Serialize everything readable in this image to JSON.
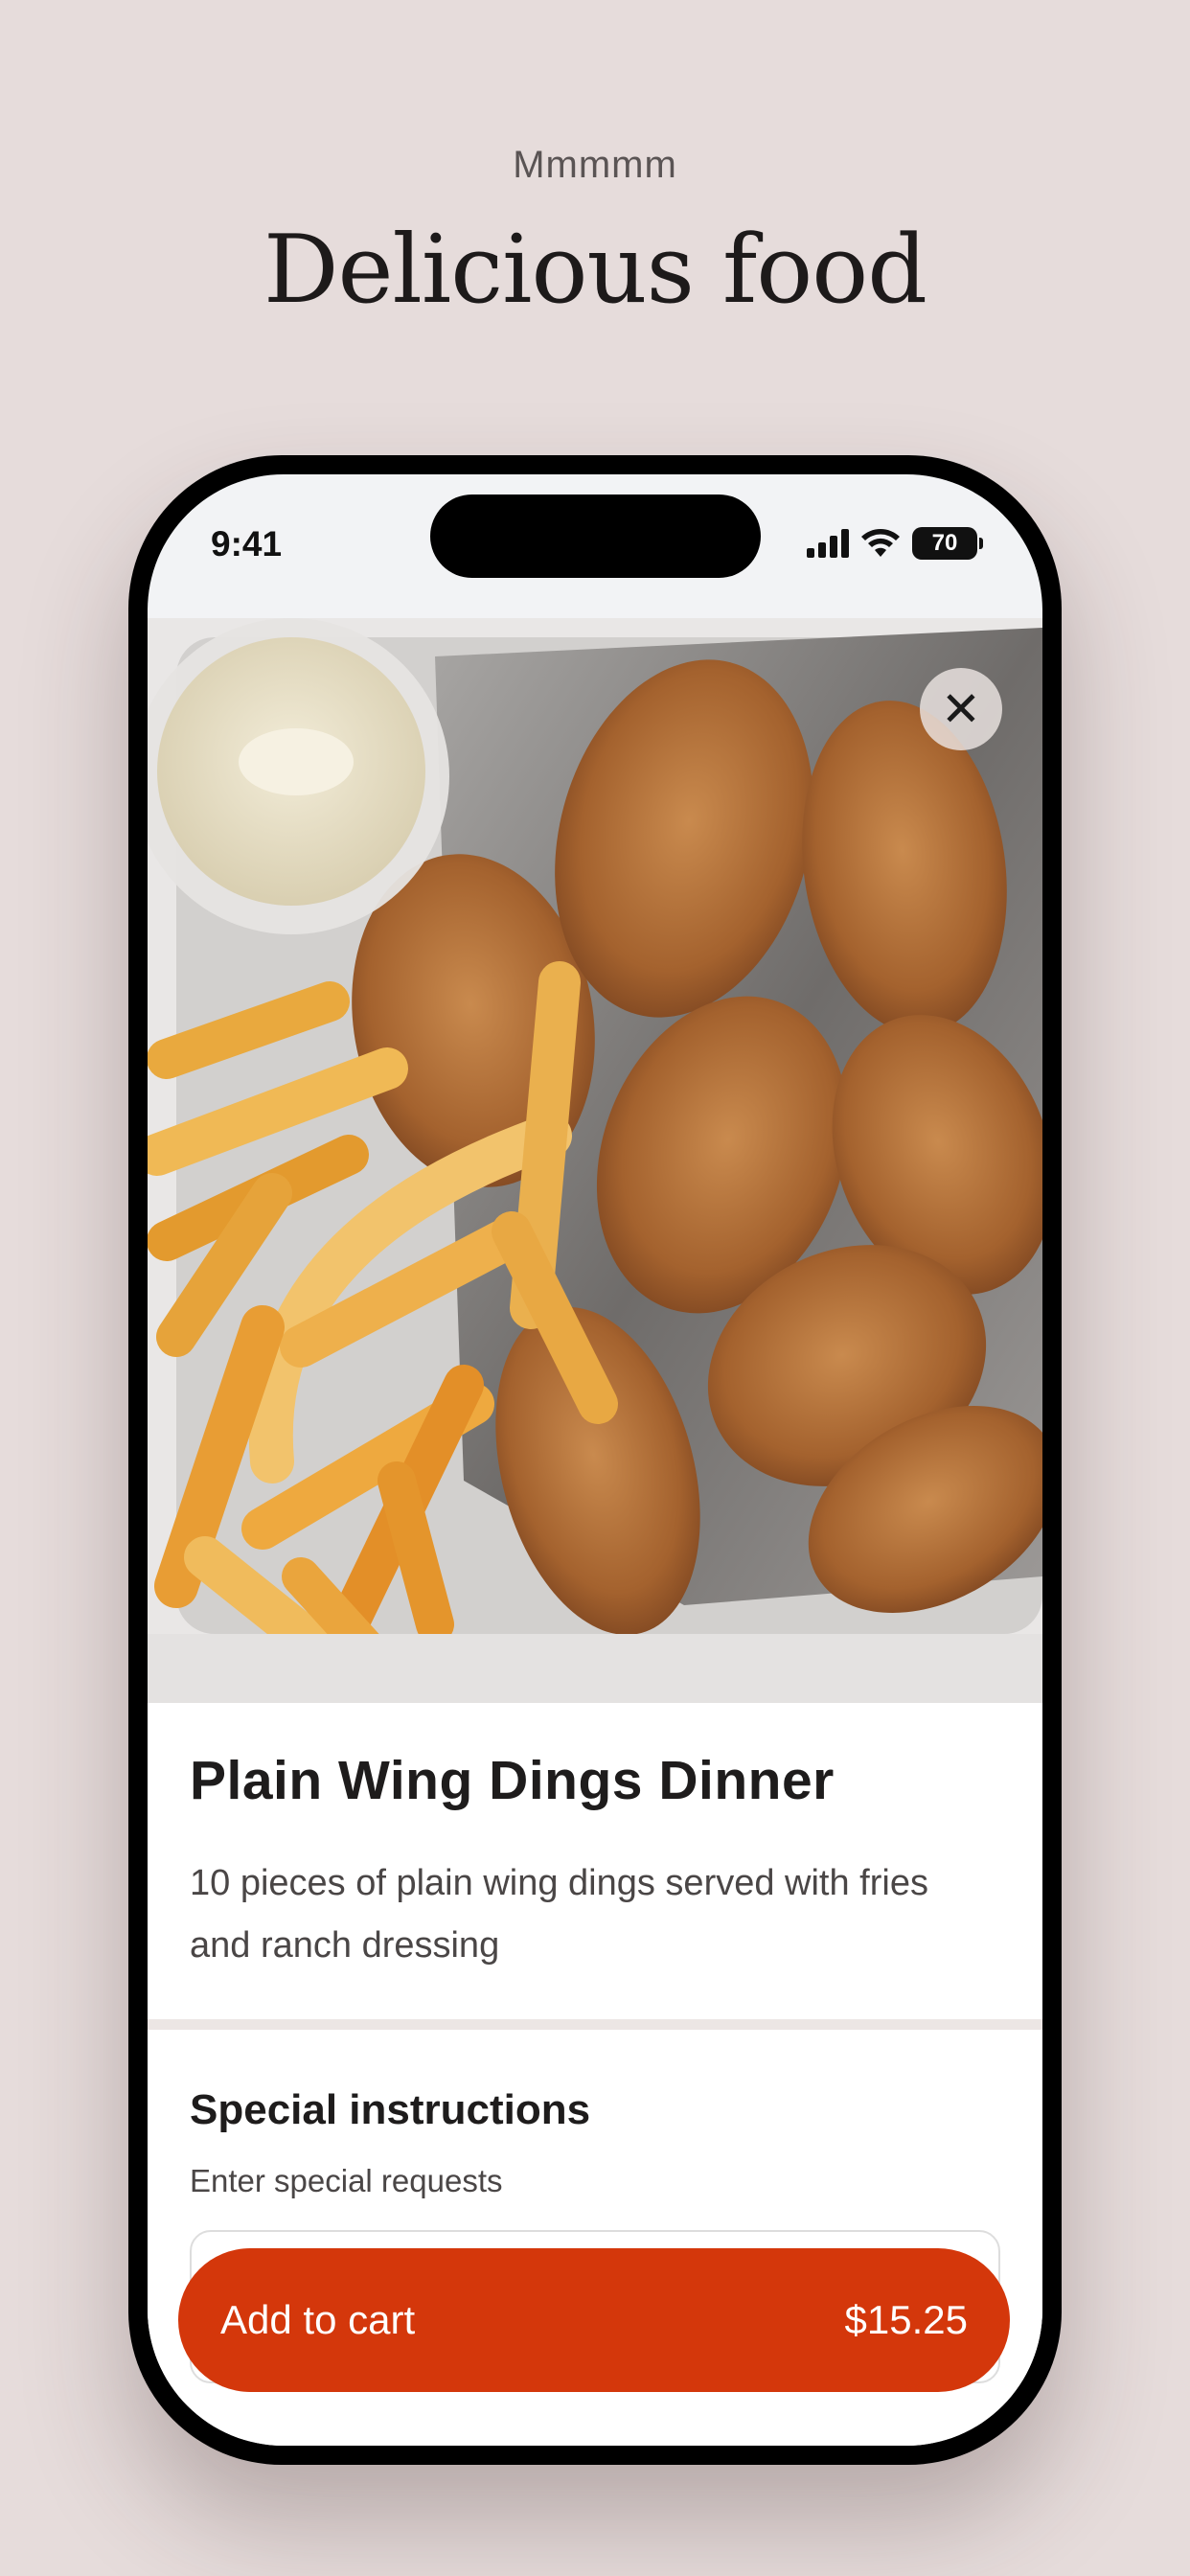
{
  "promo": {
    "kicker": "Mmmmm",
    "title": "Delicious food"
  },
  "status_bar": {
    "time": "9:41",
    "battery": "70",
    "icons": [
      "signal-icon",
      "wifi-icon",
      "battery-icon"
    ]
  },
  "item": {
    "close_icon": "close-icon",
    "title": "Plain Wing Dings Dinner",
    "description": "10 pieces of plain wing dings served with fries and ranch dressing"
  },
  "special_instructions": {
    "title": "Special instructions",
    "subtitle": "Enter special requests",
    "value": ""
  },
  "cart_button": {
    "label": "Add to cart",
    "price": "$15.25"
  },
  "colors": {
    "background": "#e6dcdb",
    "accent": "#d4370b"
  }
}
